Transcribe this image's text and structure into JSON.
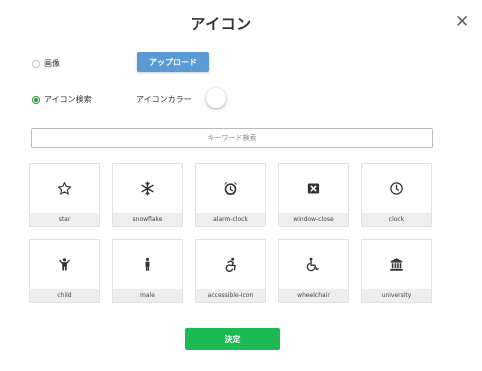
{
  "dialog": {
    "title": "アイコン",
    "close_glyph": "✕"
  },
  "options": {
    "image": {
      "label": "画像",
      "selected": false
    },
    "icon_search": {
      "label": "アイコン検索",
      "selected": true
    },
    "upload_label": "アップロード",
    "icon_color_label": "アイコンカラー",
    "icon_color_value": "#ffffff"
  },
  "search": {
    "placeholder": "キーワード検索",
    "value": ""
  },
  "icons": [
    {
      "name": "star",
      "icon": "star-icon"
    },
    {
      "name": "snowflake",
      "icon": "snowflake-icon"
    },
    {
      "name": "alarm-clock",
      "icon": "alarm-clock-icon"
    },
    {
      "name": "window-close",
      "icon": "window-close-icon"
    },
    {
      "name": "clock",
      "icon": "clock-icon"
    },
    {
      "name": "child",
      "icon": "child-icon"
    },
    {
      "name": "male",
      "icon": "male-icon"
    },
    {
      "name": "accessible-icon",
      "icon": "accessible-icon"
    },
    {
      "name": "wheelchair",
      "icon": "wheelchair-icon"
    },
    {
      "name": "university",
      "icon": "university-icon"
    }
  ],
  "confirm_label": "決定",
  "colors": {
    "upload": "#5b9bd5",
    "confirm": "#1db954",
    "radio_selected": "#2d9b3a"
  }
}
